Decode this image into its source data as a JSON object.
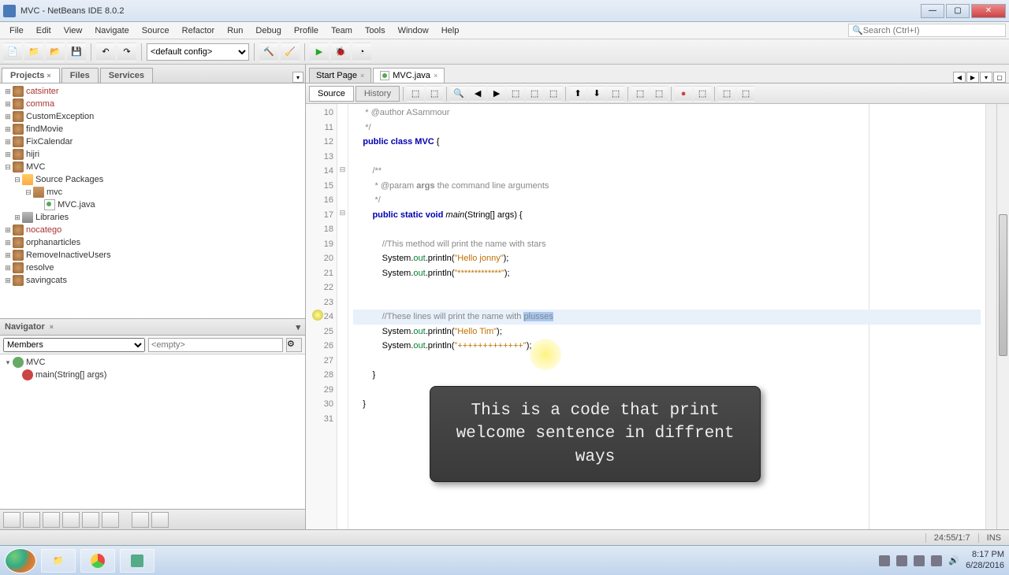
{
  "window": {
    "title": "MVC - NetBeans IDE 8.0.2"
  },
  "menu": [
    "File",
    "Edit",
    "View",
    "Navigate",
    "Source",
    "Refactor",
    "Run",
    "Debug",
    "Profile",
    "Team",
    "Tools",
    "Window",
    "Help"
  ],
  "search": {
    "placeholder": "Search (Ctrl+I)"
  },
  "toolbar": {
    "config_selected": "<default config>"
  },
  "panels": {
    "tabs": [
      "Projects",
      "Files",
      "Services"
    ],
    "active": 0
  },
  "projects": [
    {
      "label": "catsinter",
      "red": true,
      "icon": "coffee",
      "twist": "+"
    },
    {
      "label": "comma",
      "red": true,
      "icon": "coffee",
      "twist": "+"
    },
    {
      "label": "CustomException",
      "icon": "coffee",
      "twist": "+"
    },
    {
      "label": "findMovie",
      "icon": "coffee",
      "twist": "+"
    },
    {
      "label": "FixCalendar",
      "icon": "coffee",
      "twist": "+"
    },
    {
      "label": "hijri",
      "icon": "coffee",
      "twist": "+"
    },
    {
      "label": "MVC",
      "icon": "coffee",
      "twist": "-",
      "children": [
        {
          "label": "Source Packages",
          "icon": "folder",
          "twist": "-",
          "children": [
            {
              "label": "mvc",
              "icon": "pkg",
              "twist": "-",
              "children": [
                {
                  "label": "MVC.java",
                  "icon": "java"
                }
              ]
            }
          ]
        },
        {
          "label": "Libraries",
          "icon": "lib",
          "twist": "+"
        }
      ]
    },
    {
      "label": "nocatego",
      "red": true,
      "icon": "coffee",
      "twist": "+"
    },
    {
      "label": "orphanarticles",
      "icon": "coffee",
      "twist": "+"
    },
    {
      "label": "RemoveInactiveUsers",
      "icon": "coffee",
      "twist": "+"
    },
    {
      "label": "resolve",
      "icon": "coffee",
      "twist": "+"
    },
    {
      "label": "savingcats",
      "icon": "coffee",
      "twist": "+"
    }
  ],
  "navigator": {
    "title": "Navigator",
    "filter_mode": "Members",
    "filter_placeholder": "<empty>",
    "items": [
      {
        "label": "MVC",
        "icon": "class"
      },
      {
        "label": "main(String[] args)",
        "icon": "method",
        "indent": 1
      }
    ]
  },
  "editor": {
    "tabs": [
      {
        "label": "Start Page"
      },
      {
        "label": "MVC.java",
        "active": true,
        "icon": "java"
      }
    ],
    "mode_source": "Source",
    "mode_history": "History",
    "lines": [
      {
        "n": 10,
        "html": "     <span class='cmt'>* @author ASammour</span>"
      },
      {
        "n": 11,
        "html": "     <span class='cmt'>*/</span>"
      },
      {
        "n": 12,
        "html": "    <span class='kw'>public</span> <span class='kw'>class</span> <span class='kw'>MVC</span> {"
      },
      {
        "n": 13,
        "html": ""
      },
      {
        "n": 14,
        "html": "        <span class='cmt'>/**</span>",
        "fold": "-"
      },
      {
        "n": 15,
        "html": "         <span class='cmt'>* @param <b>args</b> the command line arguments</span>"
      },
      {
        "n": 16,
        "html": "         <span class='cmt'>*/</span>"
      },
      {
        "n": 17,
        "html": "        <span class='kw'>public</span> <span class='kw'>static</span> <span class='kw'>void</span> <span class='mth'>main</span>(String[] args) {",
        "fold": "-"
      },
      {
        "n": 18,
        "html": ""
      },
      {
        "n": 19,
        "html": "            <span class='cmt'>//This method will print the name with stars</span>"
      },
      {
        "n": 20,
        "html": "            System.<span class='fld'>out</span>.println(<span class='str'>\"Hello jonny\"</span>);"
      },
      {
        "n": 21,
        "html": "            System.<span class='fld'>out</span>.println(<span class='str'>\"*************\"</span>);"
      },
      {
        "n": 22,
        "html": ""
      },
      {
        "n": 23,
        "html": ""
      },
      {
        "n": 24,
        "html": "            <span class='cmt'>//These lines will print the name with </span><span class='cmt sel'>plusses</span>",
        "hl": true,
        "bulb": true
      },
      {
        "n": 25,
        "html": "            System.<span class='fld'>out</span>.println(<span class='str'>\"Hello Tim\"</span>);"
      },
      {
        "n": 26,
        "html": "            System.<span class='fld'>out</span>.println(<span class='str'>\"+++++++++++++\"</span>);"
      },
      {
        "n": 27,
        "html": ""
      },
      {
        "n": 28,
        "html": "        }"
      },
      {
        "n": 29,
        "html": ""
      },
      {
        "n": 30,
        "html": "    }"
      },
      {
        "n": 31,
        "html": ""
      }
    ]
  },
  "tooltip": "This is a code that print welcome sentence in diffrent ways",
  "status": {
    "pos": "24:55/1:7",
    "ins": "INS"
  },
  "systray": {
    "time": "8:17 PM",
    "date": "6/28/2016"
  }
}
